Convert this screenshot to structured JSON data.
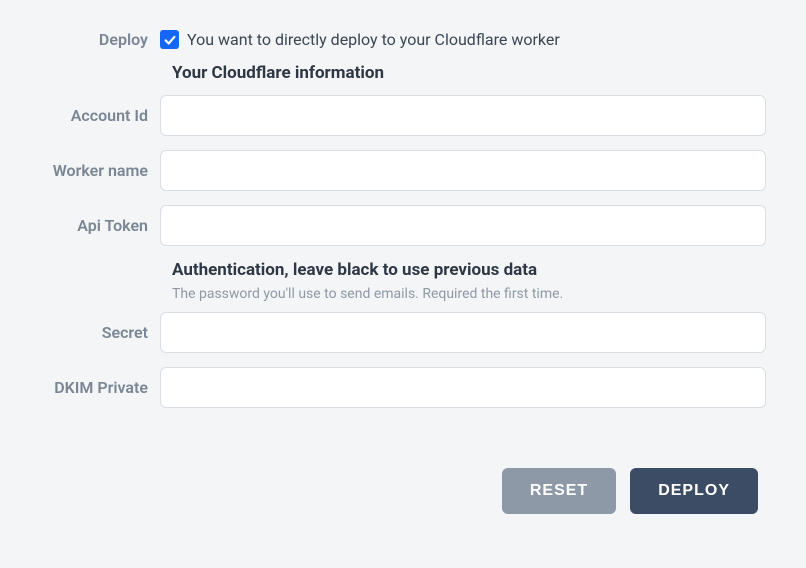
{
  "deploy": {
    "label": "Deploy",
    "checkbox_label": "You want to directly deploy to your Cloudflare worker",
    "checked": true
  },
  "cloudflare_section": {
    "title": "Your Cloudflare information",
    "fields": {
      "account_id": {
        "label": "Account Id",
        "value": ""
      },
      "worker_name": {
        "label": "Worker name",
        "value": ""
      },
      "api_token": {
        "label": "Api Token",
        "value": ""
      }
    }
  },
  "auth_section": {
    "title": "Authentication, leave black to use previous data",
    "subtitle": "The password you'll use to send emails. Required the first time.",
    "fields": {
      "secret": {
        "label": "Secret",
        "value": ""
      },
      "dkim_private": {
        "label": "DKIM Private",
        "value": ""
      }
    }
  },
  "buttons": {
    "reset": "RESET",
    "deploy": "DEPLOY"
  }
}
